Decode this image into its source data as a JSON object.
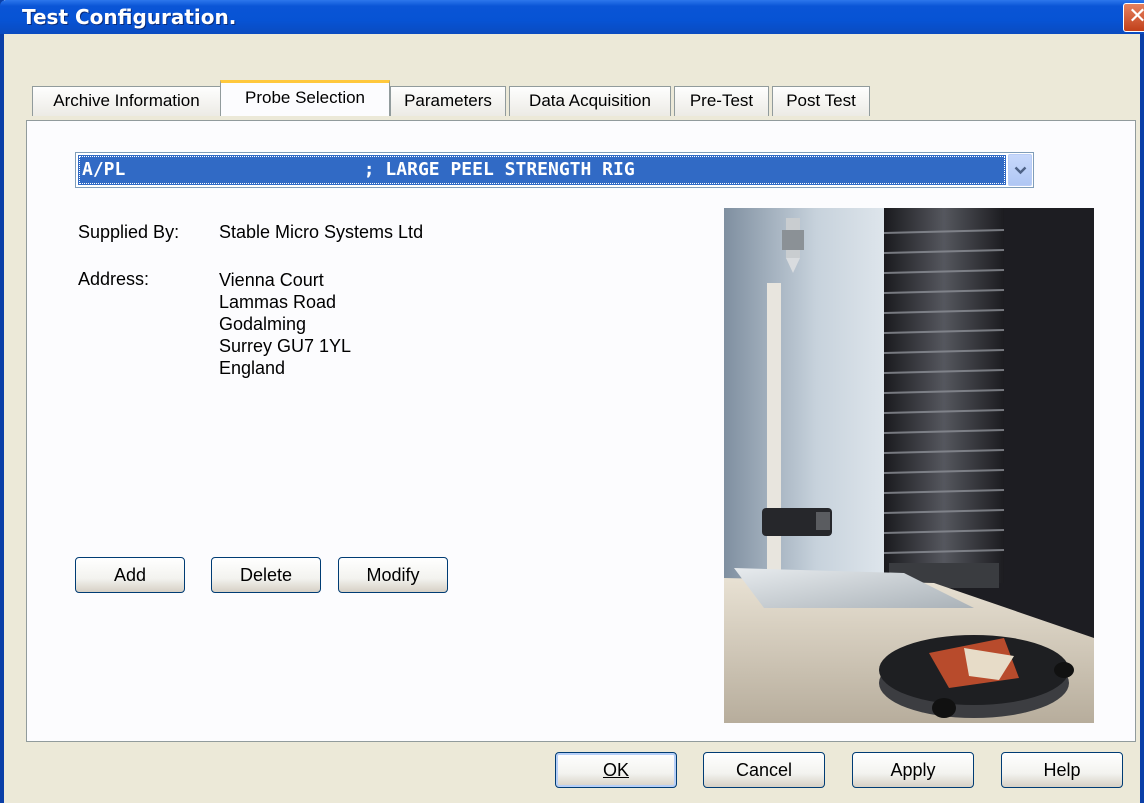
{
  "window": {
    "title": "Test Configuration.",
    "close_label": "✕"
  },
  "tabs": [
    {
      "label": "Archive Information"
    },
    {
      "label": "Probe Selection"
    },
    {
      "label": "Parameters"
    },
    {
      "label": "Data Acquisition"
    },
    {
      "label": "Pre-Test"
    },
    {
      "label": "Post Test"
    }
  ],
  "active_tab": "Probe Selection",
  "probe": {
    "selected": "A/PL                      ; LARGE PEEL STRENGTH RIG",
    "supplied_by_label": "Supplied By:",
    "supplied_by_value": "Stable Micro Systems Ltd",
    "address_label": "Address:",
    "address_lines": [
      "Vienna Court",
      "Lammas Road",
      "Godalming",
      "Surrey GU7 1YL",
      "England"
    ]
  },
  "panel_buttons": {
    "add": "Add",
    "delete": "Delete",
    "modify": "Modify"
  },
  "footer_buttons": {
    "ok": "OK",
    "cancel": "Cancel",
    "apply": "Apply",
    "help": "Help"
  },
  "colors": {
    "selection": "#316ac5",
    "titlebar": "#0753d4",
    "active_tab_accent": "#ffc83c"
  },
  "icons": {
    "dropdown": "chevron-down-icon",
    "close": "close-icon"
  }
}
